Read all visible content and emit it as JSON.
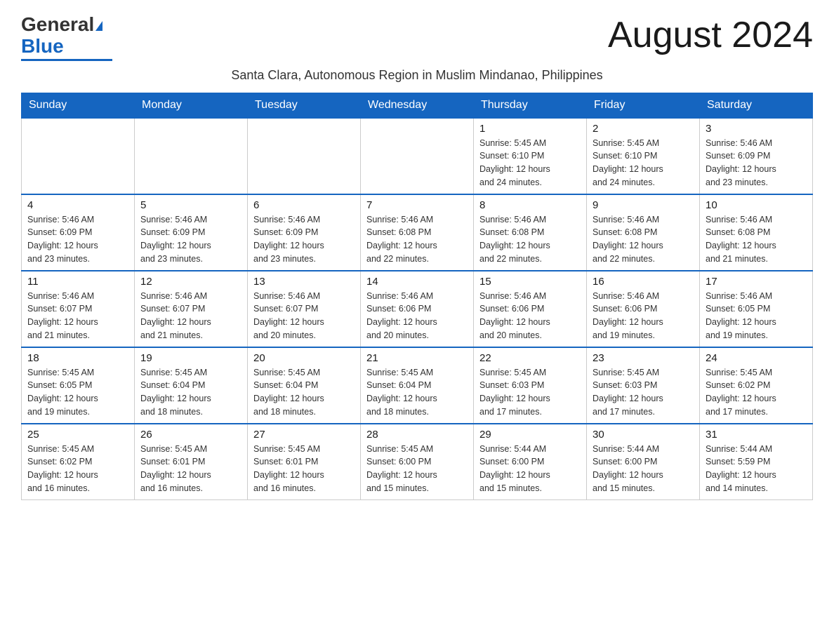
{
  "header": {
    "logo_general": "General",
    "logo_blue": "Blue",
    "month_title": "August 2024",
    "subtitle": "Santa Clara, Autonomous Region in Muslim Mindanao, Philippines"
  },
  "days_of_week": [
    "Sunday",
    "Monday",
    "Tuesday",
    "Wednesday",
    "Thursday",
    "Friday",
    "Saturday"
  ],
  "weeks": [
    [
      {
        "day": "",
        "info": ""
      },
      {
        "day": "",
        "info": ""
      },
      {
        "day": "",
        "info": ""
      },
      {
        "day": "",
        "info": ""
      },
      {
        "day": "1",
        "info": "Sunrise: 5:45 AM\nSunset: 6:10 PM\nDaylight: 12 hours\nand 24 minutes."
      },
      {
        "day": "2",
        "info": "Sunrise: 5:45 AM\nSunset: 6:10 PM\nDaylight: 12 hours\nand 24 minutes."
      },
      {
        "day": "3",
        "info": "Sunrise: 5:46 AM\nSunset: 6:09 PM\nDaylight: 12 hours\nand 23 minutes."
      }
    ],
    [
      {
        "day": "4",
        "info": "Sunrise: 5:46 AM\nSunset: 6:09 PM\nDaylight: 12 hours\nand 23 minutes."
      },
      {
        "day": "5",
        "info": "Sunrise: 5:46 AM\nSunset: 6:09 PM\nDaylight: 12 hours\nand 23 minutes."
      },
      {
        "day": "6",
        "info": "Sunrise: 5:46 AM\nSunset: 6:09 PM\nDaylight: 12 hours\nand 23 minutes."
      },
      {
        "day": "7",
        "info": "Sunrise: 5:46 AM\nSunset: 6:08 PM\nDaylight: 12 hours\nand 22 minutes."
      },
      {
        "day": "8",
        "info": "Sunrise: 5:46 AM\nSunset: 6:08 PM\nDaylight: 12 hours\nand 22 minutes."
      },
      {
        "day": "9",
        "info": "Sunrise: 5:46 AM\nSunset: 6:08 PM\nDaylight: 12 hours\nand 22 minutes."
      },
      {
        "day": "10",
        "info": "Sunrise: 5:46 AM\nSunset: 6:08 PM\nDaylight: 12 hours\nand 21 minutes."
      }
    ],
    [
      {
        "day": "11",
        "info": "Sunrise: 5:46 AM\nSunset: 6:07 PM\nDaylight: 12 hours\nand 21 minutes."
      },
      {
        "day": "12",
        "info": "Sunrise: 5:46 AM\nSunset: 6:07 PM\nDaylight: 12 hours\nand 21 minutes."
      },
      {
        "day": "13",
        "info": "Sunrise: 5:46 AM\nSunset: 6:07 PM\nDaylight: 12 hours\nand 20 minutes."
      },
      {
        "day": "14",
        "info": "Sunrise: 5:46 AM\nSunset: 6:06 PM\nDaylight: 12 hours\nand 20 minutes."
      },
      {
        "day": "15",
        "info": "Sunrise: 5:46 AM\nSunset: 6:06 PM\nDaylight: 12 hours\nand 20 minutes."
      },
      {
        "day": "16",
        "info": "Sunrise: 5:46 AM\nSunset: 6:06 PM\nDaylight: 12 hours\nand 19 minutes."
      },
      {
        "day": "17",
        "info": "Sunrise: 5:46 AM\nSunset: 6:05 PM\nDaylight: 12 hours\nand 19 minutes."
      }
    ],
    [
      {
        "day": "18",
        "info": "Sunrise: 5:45 AM\nSunset: 6:05 PM\nDaylight: 12 hours\nand 19 minutes."
      },
      {
        "day": "19",
        "info": "Sunrise: 5:45 AM\nSunset: 6:04 PM\nDaylight: 12 hours\nand 18 minutes."
      },
      {
        "day": "20",
        "info": "Sunrise: 5:45 AM\nSunset: 6:04 PM\nDaylight: 12 hours\nand 18 minutes."
      },
      {
        "day": "21",
        "info": "Sunrise: 5:45 AM\nSunset: 6:04 PM\nDaylight: 12 hours\nand 18 minutes."
      },
      {
        "day": "22",
        "info": "Sunrise: 5:45 AM\nSunset: 6:03 PM\nDaylight: 12 hours\nand 17 minutes."
      },
      {
        "day": "23",
        "info": "Sunrise: 5:45 AM\nSunset: 6:03 PM\nDaylight: 12 hours\nand 17 minutes."
      },
      {
        "day": "24",
        "info": "Sunrise: 5:45 AM\nSunset: 6:02 PM\nDaylight: 12 hours\nand 17 minutes."
      }
    ],
    [
      {
        "day": "25",
        "info": "Sunrise: 5:45 AM\nSunset: 6:02 PM\nDaylight: 12 hours\nand 16 minutes."
      },
      {
        "day": "26",
        "info": "Sunrise: 5:45 AM\nSunset: 6:01 PM\nDaylight: 12 hours\nand 16 minutes."
      },
      {
        "day": "27",
        "info": "Sunrise: 5:45 AM\nSunset: 6:01 PM\nDaylight: 12 hours\nand 16 minutes."
      },
      {
        "day": "28",
        "info": "Sunrise: 5:45 AM\nSunset: 6:00 PM\nDaylight: 12 hours\nand 15 minutes."
      },
      {
        "day": "29",
        "info": "Sunrise: 5:44 AM\nSunset: 6:00 PM\nDaylight: 12 hours\nand 15 minutes."
      },
      {
        "day": "30",
        "info": "Sunrise: 5:44 AM\nSunset: 6:00 PM\nDaylight: 12 hours\nand 15 minutes."
      },
      {
        "day": "31",
        "info": "Sunrise: 5:44 AM\nSunset: 5:59 PM\nDaylight: 12 hours\nand 14 minutes."
      }
    ]
  ]
}
